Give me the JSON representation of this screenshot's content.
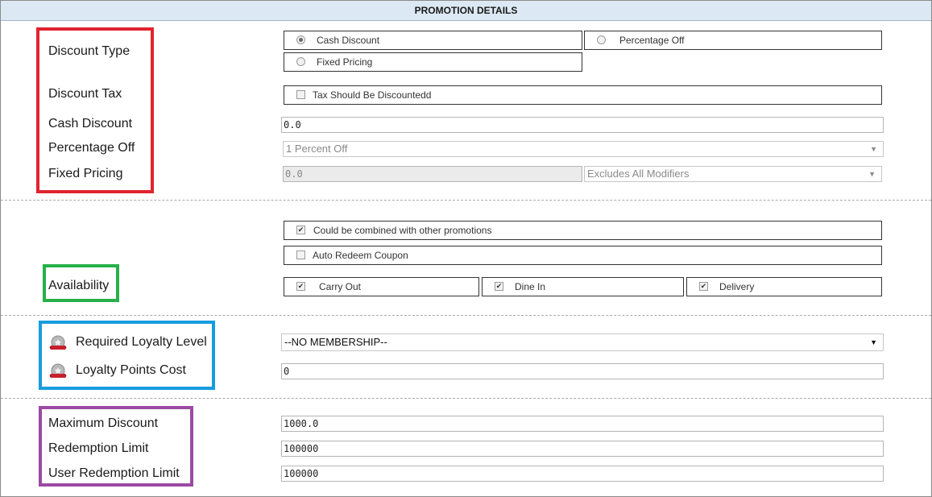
{
  "header": {
    "title": "PROMOTION DETAILS"
  },
  "discount": {
    "type_label": "Discount Type",
    "tax_label": "Discount Tax",
    "cash_label": "Cash Discount",
    "percentage_label": "Percentage Off",
    "fixed_label": "Fixed Pricing",
    "type_options": [
      {
        "label": "Cash Discount",
        "selected": true
      },
      {
        "label": "Percentage Off",
        "selected": false
      },
      {
        "label": "Fixed Pricing",
        "selected": false
      }
    ],
    "tax_checkbox": {
      "label": "Tax Should Be Discountedd",
      "checked": false
    },
    "cash_value": "0.0",
    "percentage_value": "1 Percent Off",
    "fixed_value": "0.0",
    "fixed_modifier": "Excludes All Modifiers"
  },
  "availability": {
    "label": "Availability",
    "combine": {
      "label": "Could be combined with other promotions",
      "checked": true
    },
    "auto_redeem": {
      "label": "Auto Redeem Coupon",
      "checked": false
    },
    "carry_out": {
      "label": "Carry Out",
      "checked": true
    },
    "dine_in": {
      "label": "Dine In",
      "checked": true
    },
    "delivery": {
      "label": "Delivery",
      "checked": true
    }
  },
  "loyalty": {
    "level_label": "Required Loyalty Level",
    "points_label": "Loyalty Points Cost",
    "level_value": "--NO MEMBERSHIP--",
    "points_value": "0",
    "icon": "loyalty-badge-icon"
  },
  "limits": {
    "max_discount_label": "Maximum Discount",
    "redemption_label": "Redemption Limit",
    "user_redemption_label": "User Redemption Limit",
    "max_discount_value": "1000.0",
    "redemption_value": "100000",
    "user_redemption_value": "100000"
  },
  "colors": {
    "header_bg": "#dce9f4",
    "highlight_red": "#e0242f",
    "highlight_green": "#27b04a",
    "highlight_blue": "#189ce0",
    "highlight_purple": "#9b4aa3"
  }
}
